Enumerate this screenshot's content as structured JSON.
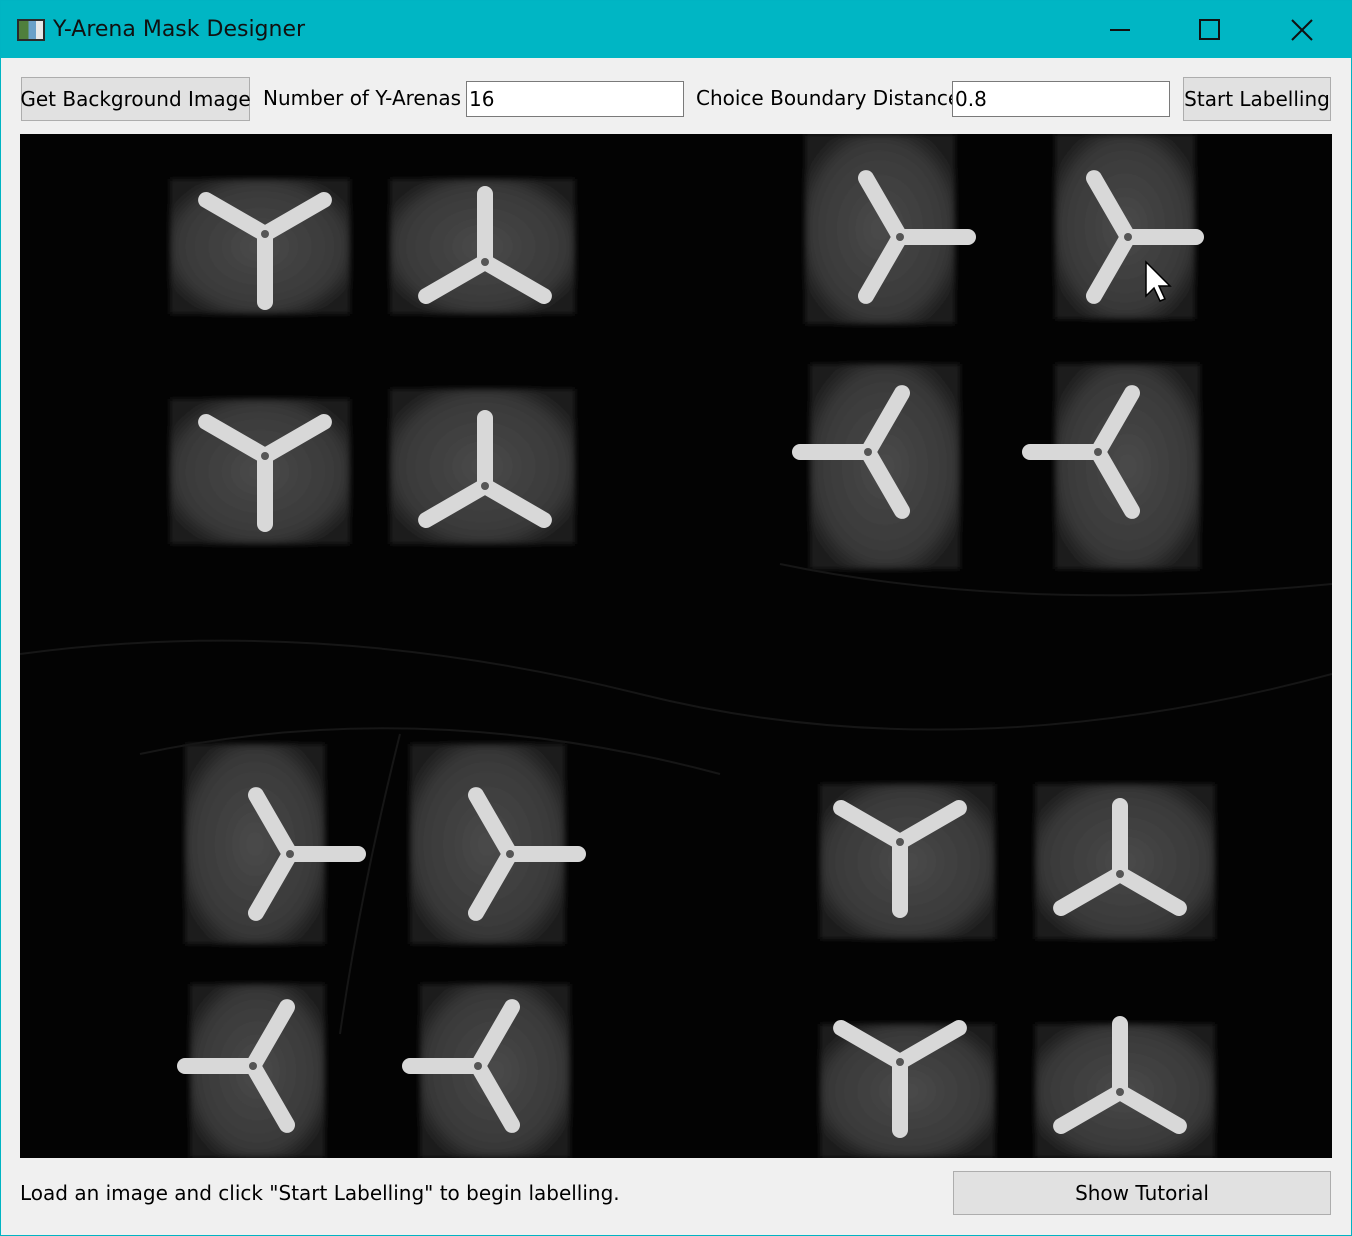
{
  "window": {
    "title": "Y-Arena Mask Designer",
    "accent_color": "#00b4c3",
    "icons": {
      "app": "app-icon",
      "minimize": "minimize-icon",
      "maximize": "maximize-icon",
      "close": "close-icon"
    }
  },
  "toolbar": {
    "get_background_label": "Get Background Image",
    "num_arenas_label": "Number of Y-Arenas",
    "num_arenas_value": "16",
    "choice_boundary_label": "Choice Boundary Distance",
    "choice_boundary_value": "0.8",
    "start_labelling_label": "Start Labelling"
  },
  "viewer": {
    "image_description_icon": "arena-image",
    "arena_count_visible": 16
  },
  "footer": {
    "status_text": "Load an image and click \"Start Labelling\" to begin labelling.",
    "tutorial_label": "Show Tutorial"
  }
}
